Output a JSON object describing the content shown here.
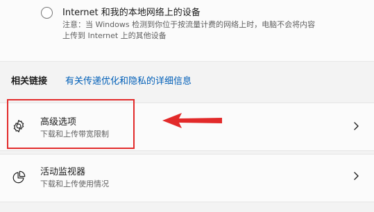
{
  "network_option": {
    "title": "Internet 和我的本地网络上的设备",
    "note_line1": "注意：当 Windows 检测到你位于按流量计费的网络上时，电脑不会将内容",
    "note_line2": "上传到 Internet 上的其他设备"
  },
  "related_links": {
    "label": "相关链接",
    "link": "有关传递优化和隐私的详细信息"
  },
  "rows": [
    {
      "title": "高级选项",
      "subtitle": "下载和上传带宽限制",
      "icon": "gear-icon"
    },
    {
      "title": "活动监视器",
      "subtitle": "下载和上传使用情况",
      "icon": "pie-chart-icon"
    }
  ],
  "annotation": {
    "highlight_color": "#e22a2a"
  }
}
